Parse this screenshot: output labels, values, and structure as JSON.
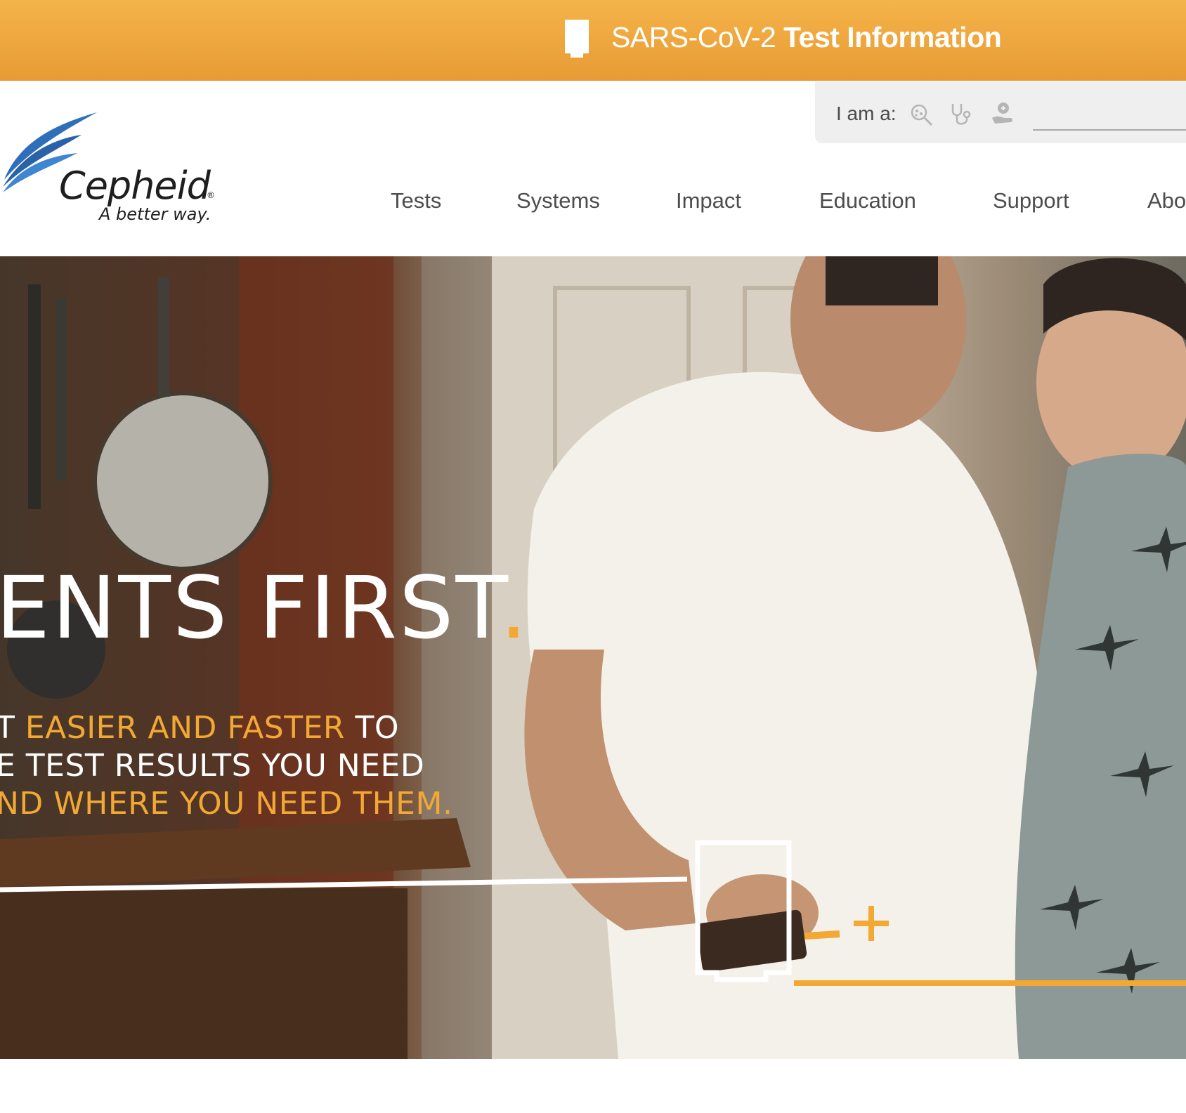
{
  "banner": {
    "prefix": "SARS-CoV-2 ",
    "bold": "Test Information"
  },
  "logo": {
    "name": "Cepheid",
    "registered": "®",
    "tagline": "A better way."
  },
  "audience": {
    "label": "I am a:",
    "icons": [
      "lab-professional-icon",
      "clinician-stethoscope-icon",
      "patient-icon"
    ]
  },
  "nav": {
    "items": [
      "Tests",
      "Systems",
      "Impact",
      "Education",
      "Support",
      "Abo"
    ]
  },
  "hero": {
    "headline": "ENTS FIRST",
    "headline_dot": ".",
    "line1_a": "T ",
    "line1_b": "EASIER AND FASTER",
    "line1_c": " TO",
    "line2": "E TEST RESULTS YOU NEED",
    "line3": "ND WHERE YOU NEED THEM."
  },
  "colors": {
    "banner": "#f0a83e",
    "accent": "#f2a833",
    "logo_blue": "#2f6fba",
    "nav_text": "#4d4d4d"
  }
}
